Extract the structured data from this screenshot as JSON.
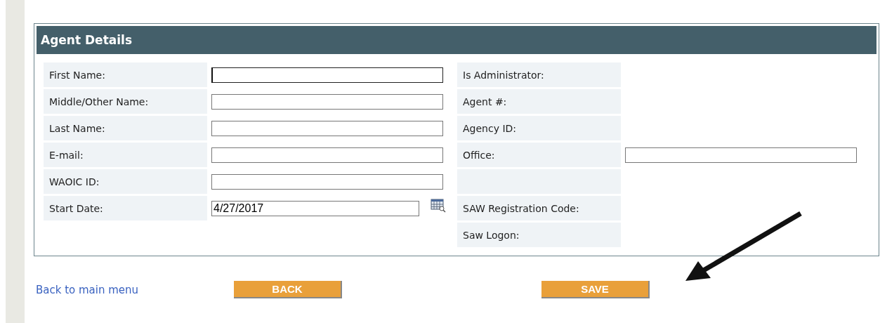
{
  "panel": {
    "title": "Agent Details",
    "left_rows": [
      {
        "label": "First Name:",
        "kind": "text",
        "focused": true
      },
      {
        "label": "Middle/Other Name:",
        "kind": "text",
        "focused": false
      },
      {
        "label": "Last Name:",
        "kind": "text",
        "focused": false
      },
      {
        "label": "E-mail:",
        "kind": "text",
        "focused": false
      },
      {
        "label": "WAOIC ID:",
        "kind": "text",
        "focused": false
      },
      {
        "label": "Start Date:",
        "kind": "date",
        "value": "4/27/2017",
        "focused": false
      }
    ],
    "right_rows": [
      {
        "label": "Is Administrator:",
        "kind": "readonly"
      },
      {
        "label": "Agent #:",
        "kind": "readonly"
      },
      {
        "label": "Agency ID:",
        "kind": "readonly"
      },
      {
        "label": "Office:",
        "kind": "text"
      },
      {
        "kind": "blank"
      },
      {
        "label": "SAW Registration Code:",
        "kind": "readonly"
      },
      {
        "label": "Saw Logon:",
        "kind": "readonly"
      }
    ]
  },
  "footer": {
    "link": "Back to main menu",
    "buttons": [
      "BACK",
      "SAVE"
    ]
  }
}
